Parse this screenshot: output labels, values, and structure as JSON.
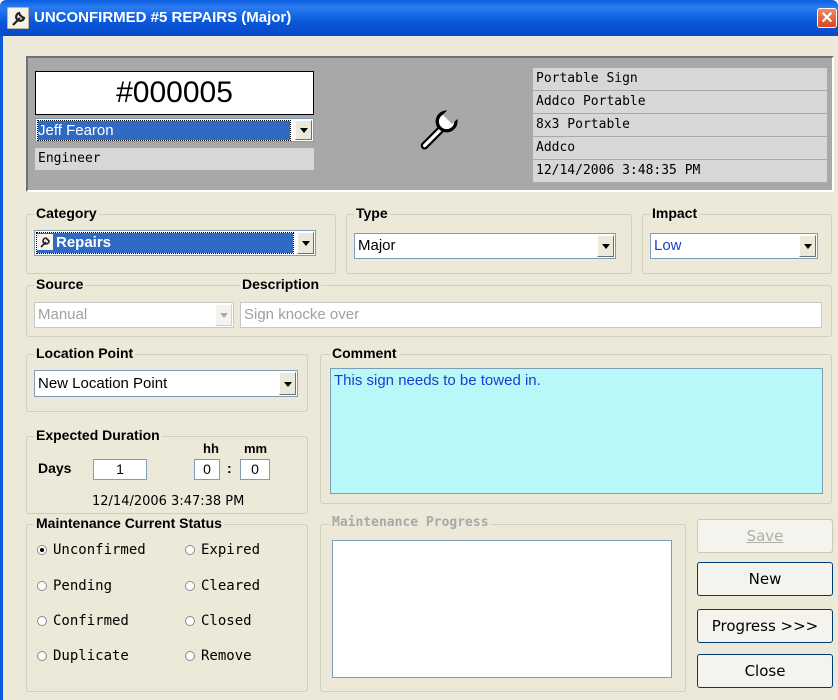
{
  "window": {
    "title": "UNCONFIRMED  #5 REPAIRS (Major)",
    "close_glyph": "✕"
  },
  "header": {
    "record_id": "#000005",
    "person": "Jeff Fearon",
    "role": "Engineer",
    "icon": "wrench-icon",
    "details": [
      "Portable Sign",
      "Addco Portable",
      "8x3 Portable",
      "Addco",
      "12/14/2006 3:48:35 PM"
    ]
  },
  "category": {
    "label": "Category",
    "value": "Repairs"
  },
  "type": {
    "label": "Type",
    "value": "Major"
  },
  "impact": {
    "label": "Impact",
    "value": "Low",
    "color": "#1a3fd0"
  },
  "source": {
    "label": "Source",
    "value": "Manual"
  },
  "description": {
    "label": "Description",
    "value": "Sign knocke over"
  },
  "location": {
    "label": "Location Point",
    "value": "New Location Point"
  },
  "comment": {
    "label": "Comment",
    "value": "This sign needs to be towed in.",
    "bg": "#b8f8f8"
  },
  "duration": {
    "label": "Expected Duration",
    "days_label": "Days",
    "days": "1",
    "hh_label": "hh",
    "mm_label": "mm",
    "hh": "0",
    "mm": "0",
    "sep": ":",
    "timestamp": "12/14/2006 3:47:38 PM"
  },
  "status": {
    "label": "Maintenance Current Status",
    "options": [
      "Unconfirmed",
      "Expired",
      "Pending",
      "Cleared",
      "Confirmed",
      "Closed",
      "Duplicate",
      "Remove"
    ],
    "selected": "Unconfirmed"
  },
  "progress": {
    "label": "Maintenance Progress"
  },
  "buttons": {
    "save": "Save",
    "new": "New",
    "progress": "Progress >>>",
    "close": "Close"
  }
}
